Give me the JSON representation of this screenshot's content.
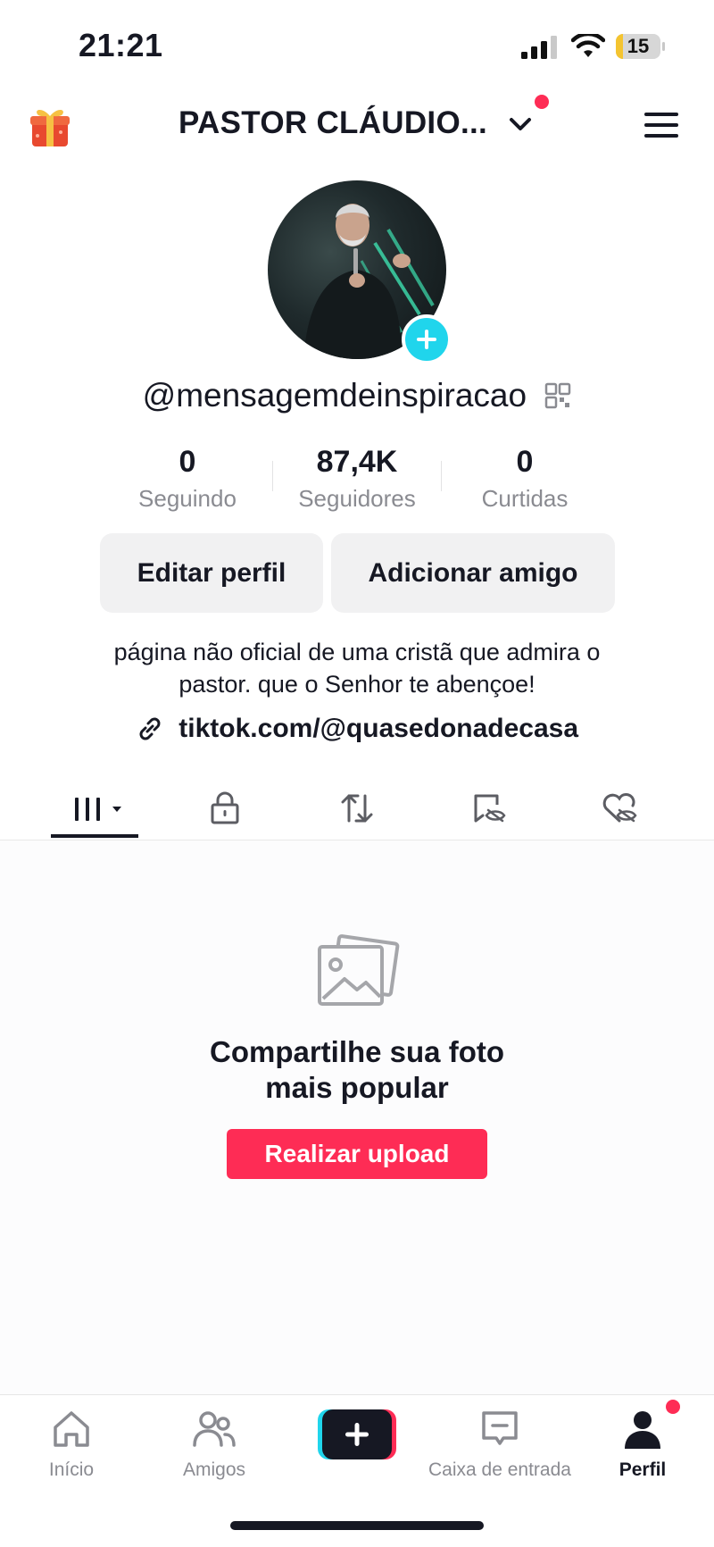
{
  "status_bar": {
    "time": "21:21",
    "battery": "15",
    "battery_level": 0.15
  },
  "header": {
    "title": "PASTOR CLÁUDIO...",
    "gift_icon": "gift-icon",
    "chevron_icon": "chevron-down-icon",
    "menu_icon": "hamburger-menu-icon",
    "has_notification": true
  },
  "profile": {
    "username": "@mensagemdeinspiracao",
    "stats": [
      {
        "value": "0",
        "label": "Seguindo"
      },
      {
        "value": "87,4K",
        "label": "Seguidores"
      },
      {
        "value": "0",
        "label": "Curtidas"
      }
    ],
    "buttons": {
      "edit": "Editar perfil",
      "add_friend": "Adicionar amigo"
    },
    "bio": [
      "página não oficial de uma cristã que admira o",
      "pastor. que o Senhor te abençoe!"
    ],
    "link": "tiktok.com/@quasedonadecasa"
  },
  "tabs": [
    {
      "icon": "grid-videos-icon",
      "active": true
    },
    {
      "icon": "lock-icon",
      "active": false
    },
    {
      "icon": "repost-icon",
      "active": false
    },
    {
      "icon": "hidden-favorites-icon",
      "active": false
    },
    {
      "icon": "hidden-liked-icon",
      "active": false
    }
  ],
  "empty_state": {
    "icon": "photos-icon",
    "title_line1": "Compartilhe sua foto",
    "title_line2": "mais popular",
    "button": "Realizar upload"
  },
  "bottom_nav": [
    {
      "label": "Início",
      "icon": "home-icon",
      "active": false
    },
    {
      "label": "Amigos",
      "icon": "friends-icon",
      "active": false
    },
    {
      "label": "",
      "icon": "create-plus-icon",
      "active": false
    },
    {
      "label": "Caixa de entrada",
      "icon": "inbox-icon",
      "active": false
    },
    {
      "label": "Perfil",
      "icon": "profile-icon",
      "active": true
    }
  ],
  "colors": {
    "accent": "#fe2c55",
    "cyan": "#20d5ec",
    "text": "#161823",
    "muted": "#8a8b91",
    "button_bg": "#f1f1f2"
  }
}
